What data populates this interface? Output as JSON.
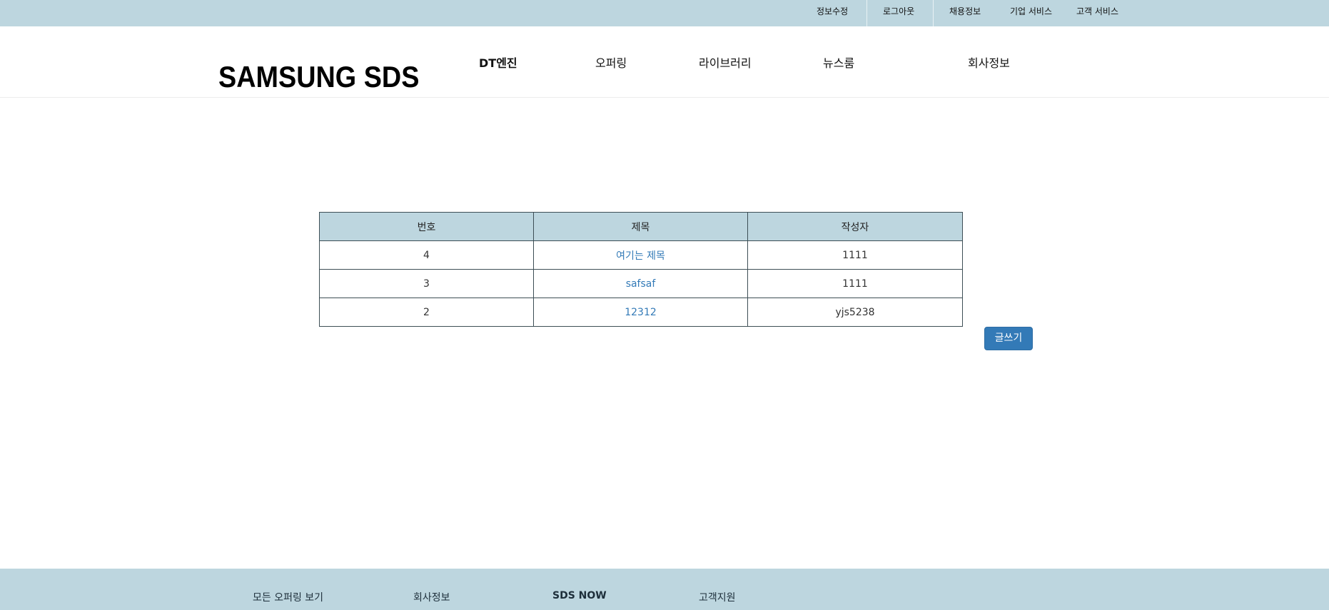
{
  "utility_nav": {
    "items": [
      "정보수정",
      "로그아웃",
      "채용정보",
      "기업 서비스",
      "고객 서비스"
    ]
  },
  "header": {
    "logo": "SAMSUNG SDS",
    "nav": [
      "DT엔진",
      "오퍼링",
      "라이브러리",
      "뉴스룸",
      "회사정보"
    ]
  },
  "board": {
    "columns": [
      "번호",
      "제목",
      "작성자"
    ],
    "rows": [
      {
        "no": "4",
        "title": "여기는 제목",
        "author": "1111"
      },
      {
        "no": "3",
        "title": "safsaf",
        "author": "1111"
      },
      {
        "no": "2",
        "title": "12312",
        "author": "yjs5238"
      }
    ],
    "write_button": "글쓰기"
  },
  "footer": {
    "items": [
      "모든 오퍼링 보기",
      "회사정보",
      "SDS NOW",
      "고객지원"
    ]
  },
  "colors": {
    "bar_background": "#bdd6df",
    "link": "#337ab7",
    "button": "#337ab7"
  }
}
